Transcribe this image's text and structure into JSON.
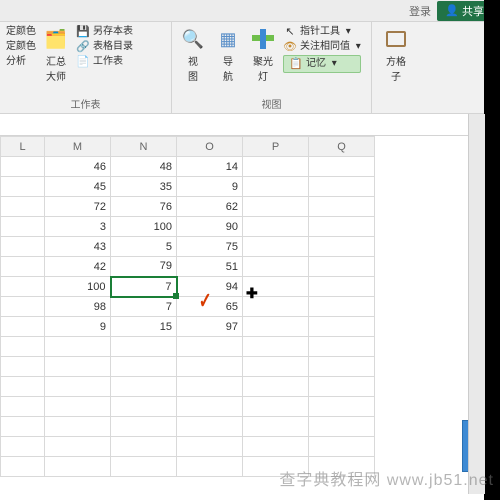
{
  "topbar": {
    "login": "登录",
    "share": "共享"
  },
  "ribbon": {
    "group1": {
      "items": [
        "定颜色",
        "定颜色",
        "分析"
      ],
      "bigbtn": "汇总\n大师",
      "save_as_table": "另存本表",
      "table_toc": "表格目录",
      "sheet_toc": "工作表",
      "label": "工作表"
    },
    "group2": {
      "view": "视\n图",
      "nav": "导\n航",
      "spot": "聚光\n灯"
    },
    "group3": {
      "pointer": "指针工具",
      "focus_same": "关注相同值",
      "memory": "记忆",
      "label": "视图"
    },
    "group4": {
      "btn": "方格\n子"
    }
  },
  "sheet": {
    "columns": [
      "L",
      "M",
      "N",
      "O",
      "P",
      "Q"
    ],
    "selected_cell": "N7",
    "chart_data": {
      "type": "table",
      "columns": [
        "M",
        "N",
        "O"
      ],
      "rows": [
        {
          "M": 46,
          "N": 48,
          "O": 14
        },
        {
          "M": 45,
          "N": 35,
          "O": 9
        },
        {
          "M": 72,
          "N": 76,
          "O": 62
        },
        {
          "M": 3,
          "N": 100,
          "O": 90
        },
        {
          "M": 43,
          "N": 5,
          "O": 75
        },
        {
          "M": 42,
          "N": 79,
          "O": 51
        },
        {
          "M": 100,
          "N": 7,
          "O": 94
        },
        {
          "M": 98,
          "N": 7,
          "O": 65
        },
        {
          "M": 9,
          "N": 15,
          "O": 97
        }
      ]
    }
  },
  "watermark": "查字典教程网 www.jb51.net"
}
